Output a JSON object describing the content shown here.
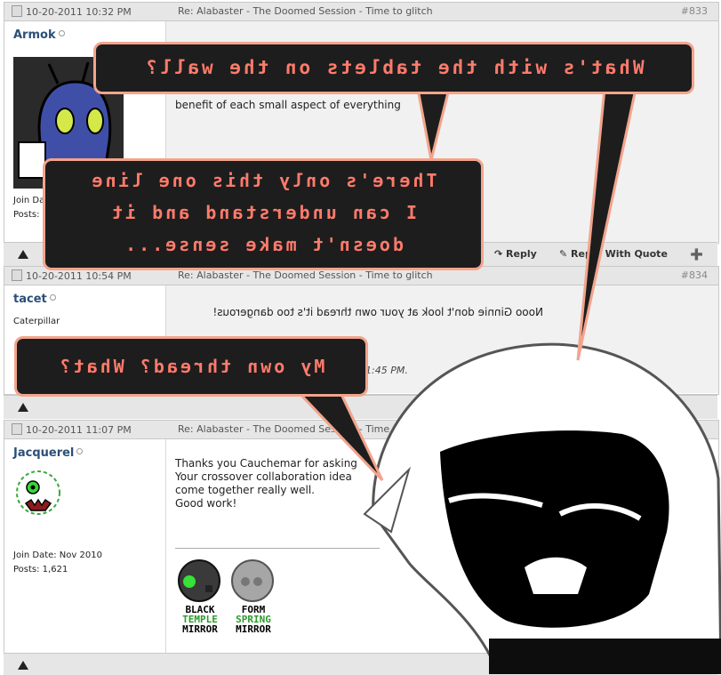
{
  "posts": [
    {
      "date": "10-20-2011 10:32 PM",
      "title": "Re: Alabaster - The Doomed Session - Time to glitch",
      "number": "#833",
      "username": "Armok",
      "join_label": "Join Da",
      "posts_label": "Posts:",
      "message_partial": "benefit of each small aspect of everything"
    },
    {
      "date": "10-20-2011 10:54 PM",
      "title": "Re: Alabaster - The Doomed Session - Time to glitch",
      "number": "#834",
      "username": "tacet",
      "user_title": "Caterpillar",
      "message_mirrored": "Nooo Ginnie don't look at your own thread it's too dangerous!",
      "edit_time": "1:45 PM."
    },
    {
      "date": "10-20-2011 11:07 PM",
      "title": "Re: Alabaster - The Doomed Session - Time to",
      "username": "Jacquerel",
      "join_date": "Join Date:  Nov 2010",
      "post_count": "Posts:  1,621",
      "message_lines": [
        "Thanks you Cauchemar for asking",
        "Your crossover collaboration idea",
        "come together really well.",
        "Good work!"
      ],
      "signature": {
        "left": [
          "BLACK",
          "TEMPLE",
          "MIRROR"
        ],
        "right": [
          "FORM",
          "SPRING",
          "MIRROR"
        ]
      }
    }
  ],
  "footer": {
    "reply": "Reply",
    "reply_with_quote": "Reply With Quote"
  },
  "bubbles": {
    "top": "What's with the tablets on the wall?",
    "middle": [
      "There's only this one line",
      "I can understand and it",
      "doesn't make sense..."
    ],
    "bottom": "My own thread? What?"
  },
  "colors": {
    "header_bg": "#e6e6e6",
    "username": "#2b4f78",
    "bubble_bg": "#1d1d1d",
    "bubble_text": "#ff7b6b",
    "bubble_border": "#f2a48c"
  }
}
